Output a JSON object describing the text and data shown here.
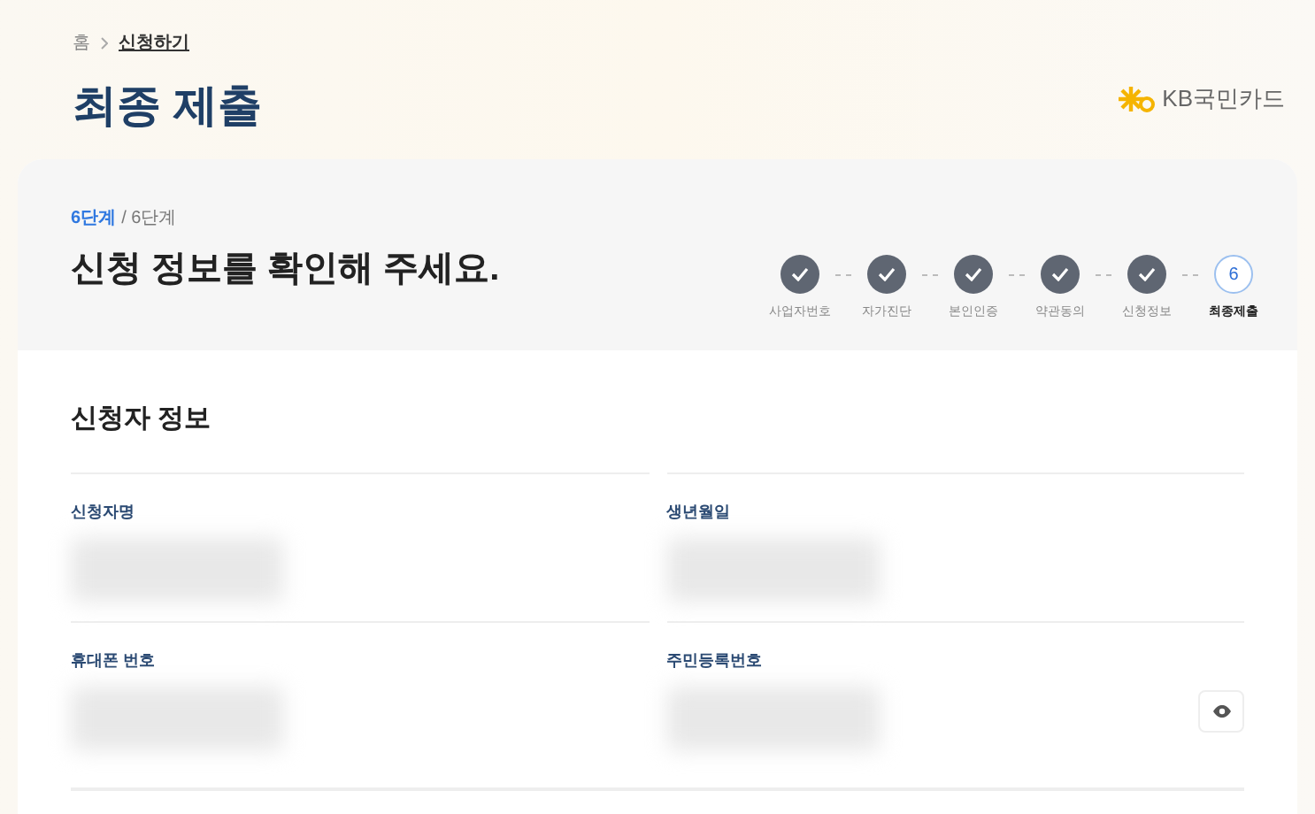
{
  "breadcrumb": [
    {
      "label": "홈",
      "current": false
    },
    {
      "label": "신청하기",
      "current": true
    }
  ],
  "page_title": "최종 제출",
  "logo": {
    "text": "KB국민카드"
  },
  "progress": {
    "current": "6단계",
    "total": "/ 6단계"
  },
  "heading": "신청 정보를 확인해 주세요.",
  "steps": [
    {
      "label": "사업자번호",
      "completed": true
    },
    {
      "label": "자가진단",
      "completed": true
    },
    {
      "label": "본인인증",
      "completed": true
    },
    {
      "label": "약관동의",
      "completed": true
    },
    {
      "label": "신청정보",
      "completed": true
    },
    {
      "label": "최종제출",
      "completed": false,
      "number": "6"
    }
  ],
  "section_title": "신청자 정보",
  "fields": [
    {
      "label": "신청자명",
      "reveal_button": false
    },
    {
      "label": "생년월일",
      "reveal_button": false
    },
    {
      "label": "휴대폰 번호",
      "reveal_button": false
    },
    {
      "label": "주민등록번호",
      "reveal_button": true
    }
  ]
}
